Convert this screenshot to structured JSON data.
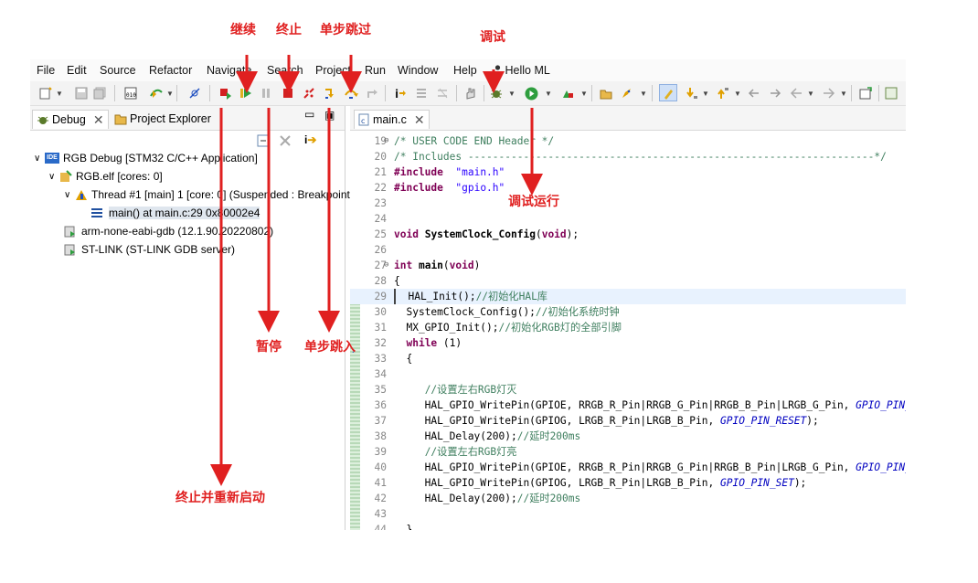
{
  "menu": [
    "File",
    "Edit",
    "Source",
    "Refactor",
    "Navigate",
    "Search",
    "Project",
    "Run",
    "Window",
    "Help"
  ],
  "user": "Hello ML",
  "left_tabs": {
    "debug": "Debug",
    "project_explorer": "Project Explorer"
  },
  "tree": {
    "root": "RGB Debug [STM32 C/C++ Application]",
    "elf": "RGB.elf [cores: 0]",
    "thread": "Thread #1 [main] 1 [core: 0] (Suspended : Breakpoint)",
    "frame": "main() at main.c:29 0x80002e4",
    "gdb": "arm-none-eabi-gdb (12.1.90.20220802)",
    "stlink": "ST-LINK (ST-LINK GDB server)"
  },
  "editor_tab": "main.c",
  "code": [
    {
      "n": "19",
      "parts": [
        [
          "cm",
          "/* USER CODE END Header */"
        ]
      ]
    },
    {
      "n": "20",
      "parts": [
        [
          "cm",
          "/* Includes ------------------------------------------------------------------*/"
        ]
      ]
    },
    {
      "n": "21",
      "parts": [
        [
          "kw",
          "#include"
        ],
        [
          "",
          "  "
        ],
        [
          "str",
          "\"main.h\""
        ]
      ]
    },
    {
      "n": "22",
      "parts": [
        [
          "kw",
          "#include"
        ],
        [
          "",
          "  "
        ],
        [
          "str",
          "\"gpio.h\""
        ]
      ]
    },
    {
      "n": "23",
      "parts": []
    },
    {
      "n": "24",
      "parts": []
    },
    {
      "n": "25",
      "parts": [
        [
          "kw",
          "void"
        ],
        [
          "",
          " "
        ],
        [
          "fn",
          "SystemClock_Config"
        ],
        [
          "",
          "("
        ],
        [
          "kw",
          "void"
        ],
        [
          "",
          ");"
        ]
      ]
    },
    {
      "n": "26",
      "parts": []
    },
    {
      "n": "27",
      "parts": [
        [
          "kw",
          "int"
        ],
        [
          "",
          " "
        ],
        [
          "fn",
          "main"
        ],
        [
          "",
          "("
        ],
        [
          "kw",
          "void"
        ],
        [
          "",
          ")"
        ]
      ]
    },
    {
      "n": "28",
      "parts": [
        [
          "",
          "{"
        ]
      ]
    },
    {
      "n": "29",
      "parts": [
        [
          "",
          "  HAL_Init();"
        ],
        [
          "cm",
          "//初始化HAL库"
        ]
      ]
    },
    {
      "n": "30",
      "parts": [
        [
          "",
          "  SystemClock_Config();"
        ],
        [
          "cm",
          "//初始化系统时钟"
        ]
      ]
    },
    {
      "n": "31",
      "parts": [
        [
          "",
          "  MX_GPIO_Init();"
        ],
        [
          "cm",
          "//初始化RGB灯的全部引脚"
        ]
      ]
    },
    {
      "n": "32",
      "parts": [
        [
          "",
          "  "
        ],
        [
          "kw",
          "while"
        ],
        [
          "",
          " (1)"
        ]
      ]
    },
    {
      "n": "33",
      "parts": [
        [
          "",
          "  {"
        ]
      ]
    },
    {
      "n": "34",
      "parts": []
    },
    {
      "n": "35",
      "parts": [
        [
          "",
          "     "
        ],
        [
          "cm",
          "//设置左右RGB灯灭"
        ]
      ]
    },
    {
      "n": "36",
      "parts": [
        [
          "",
          "     HAL_GPIO_WritePin(GPIOE, RRGB_R_Pin|RRGB_G_Pin|RRGB_B_Pin|LRGB_G_Pin, "
        ],
        [
          "mac",
          "GPIO_PIN_RESET"
        ],
        [
          "",
          ");"
        ]
      ]
    },
    {
      "n": "37",
      "parts": [
        [
          "",
          "     HAL_GPIO_WritePin(GPIOG, LRGB_R_Pin|LRGB_B_Pin, "
        ],
        [
          "mac",
          "GPIO_PIN_RESET"
        ],
        [
          "",
          ");"
        ]
      ]
    },
    {
      "n": "38",
      "parts": [
        [
          "",
          "     HAL_Delay(200);"
        ],
        [
          "cm",
          "//延时200ms"
        ]
      ]
    },
    {
      "n": "39",
      "parts": [
        [
          "",
          "     "
        ],
        [
          "cm",
          "//设置左右RGB灯亮"
        ]
      ]
    },
    {
      "n": "40",
      "parts": [
        [
          "",
          "     HAL_GPIO_WritePin(GPIOE, RRGB_R_Pin|RRGB_G_Pin|RRGB_B_Pin|LRGB_G_Pin, "
        ],
        [
          "mac",
          "GPIO_PIN_SET"
        ],
        [
          "",
          ");"
        ]
      ]
    },
    {
      "n": "41",
      "parts": [
        [
          "",
          "     HAL_GPIO_WritePin(GPIOG, LRGB_R_Pin|LRGB_B_Pin, "
        ],
        [
          "mac",
          "GPIO_PIN_SET"
        ],
        [
          "",
          ");"
        ]
      ]
    },
    {
      "n": "42",
      "parts": [
        [
          "",
          "     HAL_Delay(200);"
        ],
        [
          "cm",
          "//延时200ms"
        ]
      ]
    },
    {
      "n": "43",
      "parts": []
    },
    {
      "n": "44",
      "parts": [
        [
          "",
          "  }"
        ]
      ]
    }
  ],
  "annotations": {
    "resume": "继续",
    "terminate": "终止",
    "step_over": "单步跳过",
    "debug": "调试",
    "suspend": "暂停",
    "step_into": "单步跳入",
    "debug_run": "调试运行",
    "terminate_relaunch": "终止并重新启动"
  },
  "colors": {
    "accent_red": "#e02020",
    "run_green": "#2e9e3e",
    "code_keyword": "#7f0055",
    "code_comment": "#3f7f5f",
    "code_string": "#2a00ff"
  }
}
